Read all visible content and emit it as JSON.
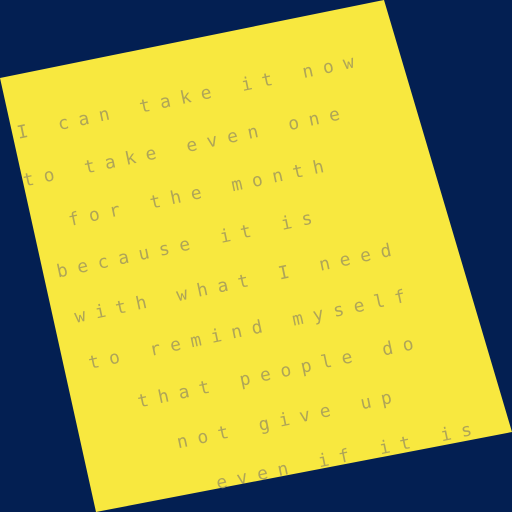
{
  "paper": {
    "background_color": "#031f52",
    "paper_color": "#f8e83f",
    "ink_color": "#a39a5c",
    "lines": [
      "I can take it now",
      "to take even one",
      "for the month",
      "because it is",
      "with what I need",
      "to remind myself",
      "that people do",
      "not give up",
      "even if it is"
    ]
  }
}
